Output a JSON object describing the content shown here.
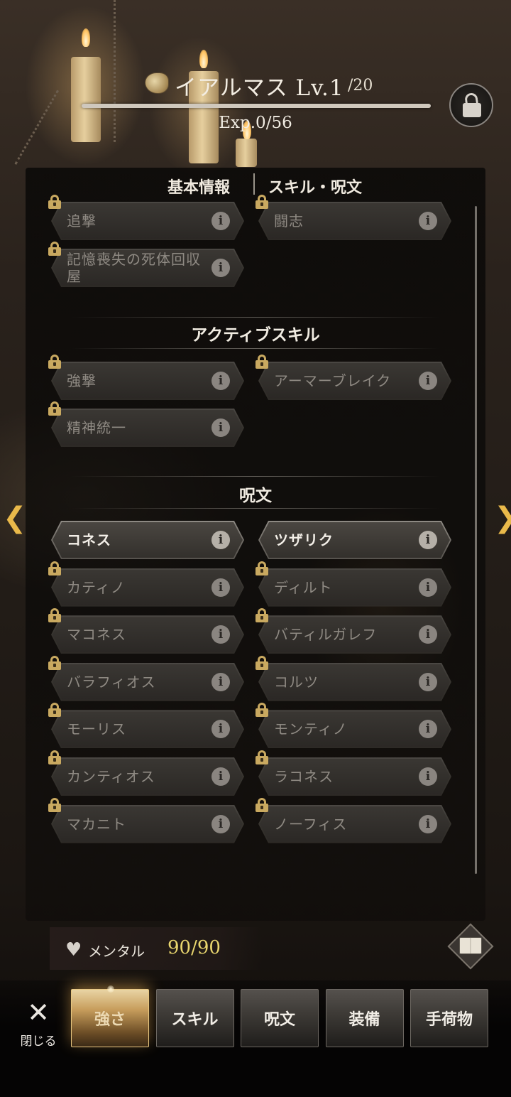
{
  "header": {
    "name_level": "イアルマス Lv.1",
    "level_max": "/20",
    "exp_text": "Exp.0/56",
    "exp_progress": 0,
    "lock_icon": "unlock-icon"
  },
  "tabs_top": {
    "basic": "基本情報",
    "skills": "スキル・呪文"
  },
  "passive_skills": [
    {
      "label": "追撃",
      "locked": true
    },
    {
      "label": "闘志",
      "locked": true
    },
    {
      "label": "記憶喪失の死体回収屋",
      "locked": true
    }
  ],
  "active_section": {
    "title": "アクティブスキル"
  },
  "active_skills": [
    {
      "label": "強撃",
      "locked": true
    },
    {
      "label": "アーマーブレイク",
      "locked": true
    },
    {
      "label": "精神統一",
      "locked": true
    }
  ],
  "spell_section": {
    "title": "呪文"
  },
  "spells": [
    {
      "label": "コネス",
      "locked": false
    },
    {
      "label": "ツザリク",
      "locked": false
    },
    {
      "label": "カティノ",
      "locked": true
    },
    {
      "label": "ディルト",
      "locked": true
    },
    {
      "label": "マコネス",
      "locked": true
    },
    {
      "label": "バティルガレフ",
      "locked": true
    },
    {
      "label": "バラフィオス",
      "locked": true
    },
    {
      "label": "コルツ",
      "locked": true
    },
    {
      "label": "モーリス",
      "locked": true
    },
    {
      "label": "モンティノ",
      "locked": true
    },
    {
      "label": "カンティオス",
      "locked": true
    },
    {
      "label": "ラコネス",
      "locked": true
    },
    {
      "label": "マカニト",
      "locked": true
    },
    {
      "label": "ノーフィス",
      "locked": true
    }
  ],
  "info_glyph": "i",
  "nav_arrows": {
    "left": "❮",
    "right": "❯"
  },
  "mental": {
    "label": "メンタル",
    "value": "90/90",
    "icon": "heart-icon"
  },
  "close": {
    "label": "閉じる",
    "glyph": "✕"
  },
  "bottom_tabs": [
    {
      "label": "強さ",
      "active": true
    },
    {
      "label": "スキル",
      "active": false
    },
    {
      "label": "呪文",
      "active": false
    },
    {
      "label": "装備",
      "active": false
    },
    {
      "label": "手荷物",
      "active": false
    }
  ],
  "colors": {
    "accent_gold": "#e9b94a",
    "mental_value": "#e9d66e",
    "lock_gold": "#c9a960"
  }
}
